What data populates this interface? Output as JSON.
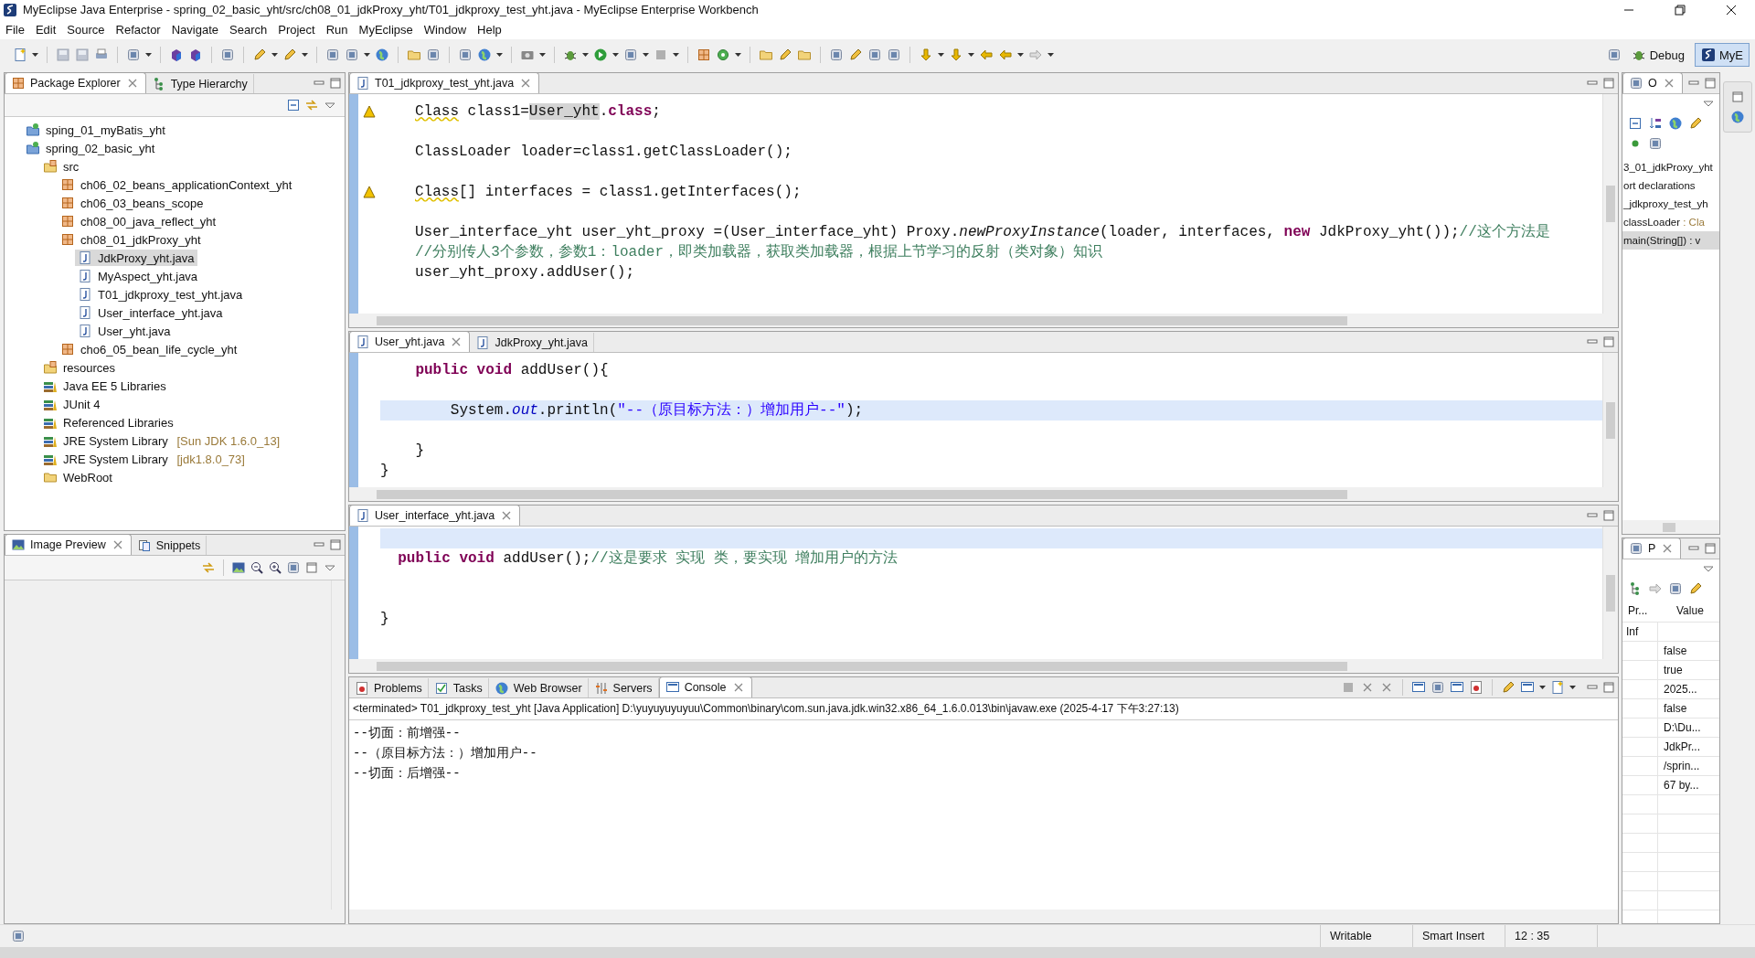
{
  "window": {
    "title": "MyEclipse Java Enterprise - spring_02_basic_yht/src/ch08_01_jdkProxy_yht/T01_jdkproxy_test_yht.java - MyEclipse Enterprise Workbench"
  },
  "menu": [
    "File",
    "Edit",
    "Source",
    "Refactor",
    "Navigate",
    "Search",
    "Project",
    "Run",
    "MyEclipse",
    "Window",
    "Help"
  ],
  "perspectives": [
    {
      "label": "Debug",
      "selected": false
    },
    {
      "label": "MyE",
      "selected": true
    }
  ],
  "package_explorer": {
    "tabs": [
      {
        "label": "Package Explorer",
        "selected": true
      },
      {
        "label": "Type Hierarchy",
        "selected": false
      }
    ],
    "items": [
      {
        "label": "sping_01_myBatis_yht",
        "kind": "project",
        "selected": false
      },
      {
        "label": "spring_02_basic_yht",
        "kind": "project",
        "selected": false,
        "children": [
          {
            "label": "src",
            "kind": "srcfolder",
            "selected": false,
            "children": [
              {
                "label": "ch06_02_beans_applicationContext_yht",
                "kind": "package",
                "selected": false
              },
              {
                "label": "ch06_03_beans_scope",
                "kind": "package",
                "selected": false
              },
              {
                "label": "ch08_00_java_reflect_yht",
                "kind": "package",
                "selected": false
              },
              {
                "label": "ch08_01_jdkProxy_yht",
                "kind": "package",
                "selected": false,
                "children": [
                  {
                    "label": "JdkProxy_yht.java",
                    "kind": "java",
                    "selected": true
                  },
                  {
                    "label": "MyAspect_yht.java",
                    "kind": "java",
                    "selected": false
                  },
                  {
                    "label": "T01_jdkproxy_test_yht.java",
                    "kind": "java",
                    "selected": false
                  },
                  {
                    "label": "User_interface_yht.java",
                    "kind": "java",
                    "selected": false
                  },
                  {
                    "label": "User_yht.java",
                    "kind": "java",
                    "selected": false
                  }
                ]
              },
              {
                "label": "cho6_05_bean_life_cycle_yht",
                "kind": "package",
                "selected": false
              }
            ]
          },
          {
            "label": "resources",
            "kind": "srcfolder",
            "selected": false
          },
          {
            "label": "Java EE 5 Libraries",
            "kind": "library",
            "selected": false
          },
          {
            "label": "JUnit 4",
            "kind": "library",
            "selected": false
          },
          {
            "label": "Referenced Libraries",
            "kind": "library",
            "selected": false
          },
          {
            "label": "JRE System Library",
            "detail": "[Sun JDK 1.6.0_13]",
            "kind": "library",
            "selected": false
          },
          {
            "label": "JRE System Library",
            "detail": "[jdk1.8.0_73]",
            "kind": "library",
            "selected": false
          },
          {
            "label": "WebRoot",
            "kind": "folder",
            "selected": false
          }
        ]
      }
    ]
  },
  "image_preview": {
    "tabs": [
      {
        "label": "Image Preview",
        "selected": true
      },
      {
        "label": "Snippets",
        "selected": false
      }
    ]
  },
  "editors": [
    {
      "tabs": [
        {
          "label": "T01_jdkproxy_test_yht.java",
          "selected": true
        }
      ],
      "lines": [
        {
          "current": false,
          "tokens": [
            {
              "kind": "warning",
              "text": "Class"
            },
            {
              "kind": "plain",
              "text": " class1="
            },
            {
              "kind": "marked",
              "text": "User_yht"
            },
            {
              "kind": "plain",
              "text": "."
            },
            {
              "kind": "keyword",
              "text": "class"
            },
            {
              "kind": "plain",
              "text": ";"
            }
          ]
        },
        {
          "current": false
        },
        {
          "current": false,
          "tokens": [
            {
              "kind": "plain",
              "text": "ClassLoader loader=class1.getClassLoader();"
            }
          ]
        },
        {
          "current": false
        },
        {
          "current": false,
          "tokens": [
            {
              "kind": "warning",
              "text": "Class"
            },
            {
              "kind": "plain",
              "text": "[] interfaces = class1.getInterfaces();"
            }
          ]
        },
        {
          "current": false
        },
        {
          "current": false,
          "tokens": [
            {
              "kind": "plain",
              "text": "User_interface_yht user_yht_proxy =(User_interface_yht) Proxy."
            },
            {
              "kind": "static",
              "text": "newProxyInstance"
            },
            {
              "kind": "plain",
              "text": "(loader, interfaces, "
            },
            {
              "kind": "keyword",
              "text": "new"
            },
            {
              "kind": "plain",
              "text": " JdkProxy_yht());"
            },
            {
              "kind": "comment",
              "text": "//这个方法是"
            }
          ]
        },
        {
          "current": false,
          "tokens": [
            {
              "kind": "comment",
              "text": "//分别传人3个参数，参数1：loader，即类加载器，获取类加载器，根据上节学习的反射（类对象）知识"
            }
          ]
        },
        {
          "current": false,
          "tokens": [
            {
              "kind": "plain",
              "text": "user_yht_proxy.addUser();"
            }
          ]
        }
      ]
    },
    {
      "tabs": [
        {
          "label": "User_yht.java",
          "selected": true
        },
        {
          "label": "JdkProxy_yht.java",
          "selected": false
        }
      ],
      "lines": [
        {
          "current": false,
          "tokens": [
            {
              "kind": "keyword",
              "text": "    public void"
            },
            {
              "kind": "plain",
              "text": " addUser(){"
            }
          ]
        },
        {
          "current": false
        },
        {
          "current": true,
          "tokens": [
            {
              "kind": "plain",
              "text": "        System."
            },
            {
              "kind": "field",
              "text": "out"
            },
            {
              "kind": "plain",
              "text": ".println("
            },
            {
              "kind": "string",
              "text": "\"--（原目标方法：）增加用户--\""
            },
            {
              "kind": "plain",
              "text": ");"
            }
          ]
        },
        {
          "current": false
        },
        {
          "current": false,
          "tokens": [
            {
              "kind": "plain",
              "text": "    }"
            }
          ]
        },
        {
          "current": false,
          "tokens": [
            {
              "kind": "plain",
              "text": "}"
            }
          ]
        }
      ]
    },
    {
      "tabs": [
        {
          "label": "User_interface_yht.java",
          "selected": true
        }
      ],
      "lines": [
        {
          "current": true
        },
        {
          "current": false,
          "tokens": [
            {
              "kind": "keyword",
              "text": "  public void"
            },
            {
              "kind": "plain",
              "text": " addUser();"
            },
            {
              "kind": "comment",
              "text": "//这是要求 实现 类，要实现 增加用户的方法"
            }
          ]
        },
        {
          "current": false
        },
        {
          "current": false
        },
        {
          "current": false,
          "tokens": [
            {
              "kind": "plain",
              "text": "}"
            }
          ]
        }
      ]
    }
  ],
  "console": {
    "tabs": [
      {
        "label": "Problems",
        "selected": false
      },
      {
        "label": "Tasks",
        "selected": false
      },
      {
        "label": "Web Browser",
        "selected": false
      },
      {
        "label": "Servers",
        "selected": false
      },
      {
        "label": "Console",
        "selected": true
      }
    ],
    "header": "<terminated> T01_jdkproxy_test_yht [Java Application] D:\\yuyuyuyuyuu\\Common\\binary\\com.sun.java.jdk.win32.x86_64_1.6.0.013\\bin\\javaw.exe (2025-4-17 下午3:27:13)",
    "output": [
      "--切面：前增强--",
      "--（原目标方法：）增加用户--",
      "--切面：后增强--"
    ]
  },
  "outline": {
    "tabs": [
      {
        "label": "O",
        "selected": true
      }
    ],
    "items": [
      {
        "label": "3_01_jdkProxy_yht",
        "selected": false
      },
      {
        "label": "ort declarations",
        "selected": false
      },
      {
        "label": "_jdkproxy_test_yh",
        "selected": false
      },
      {
        "label": "classLoader",
        "detail": ": Cla",
        "selected": false
      },
      {
        "label": "main(String[]) : v",
        "selected": true
      }
    ]
  },
  "properties": {
    "tabs": [
      {
        "label": "P",
        "selected": true
      }
    ],
    "columns": [
      "Pr...",
      "Value"
    ],
    "rows": [
      {
        "property": "Inf"
      },
      {
        "value": "false"
      },
      {
        "value": "true"
      },
      {
        "value": "2025..."
      },
      {
        "value": "false"
      },
      {
        "value": "D:\\Du..."
      },
      {
        "value": "JdkPr..."
      },
      {
        "value": "/sprin..."
      },
      {
        "value": "67  by..."
      }
    ]
  },
  "status_bar": [
    "Writable",
    "Smart Insert",
    "12 : 35"
  ]
}
